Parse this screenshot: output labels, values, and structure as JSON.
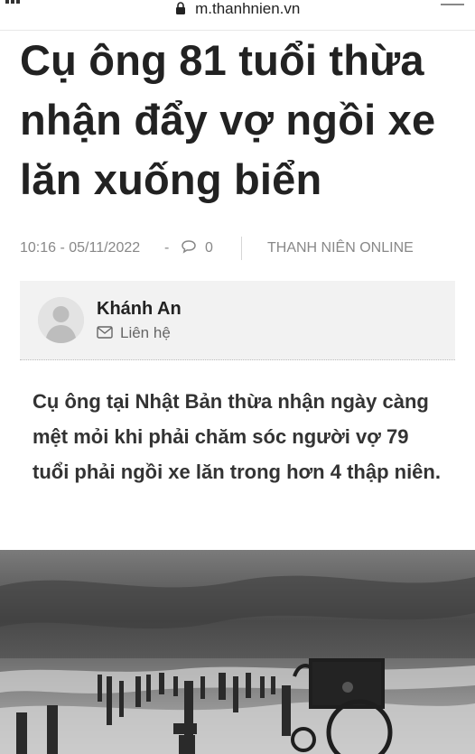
{
  "browser": {
    "url": "m.thanhnien.vn",
    "icons": {
      "lock": "lock-icon",
      "menu": "menu-icon"
    }
  },
  "article": {
    "title": "Cụ ông 81 tuổi thừa nhận đẩy vợ ngồi xe lăn xuống biển",
    "published": "10:16 - 05/11/2022",
    "separator": "-",
    "comment_count": "0",
    "source": "THANH NIÊN ONLINE",
    "author": {
      "name": "Khánh An",
      "contact_label": "Liên hệ"
    },
    "sapo": "Cụ ông tại Nhật Bản thừa nhận ngày càng mệt mỏi khi phải chăm sóc người vợ 79 tuổi phải ngồi xe lăn trong hơn 4 thập niên."
  },
  "colors": {
    "title": "#222222",
    "meta": "#888888",
    "author_box_bg": "#f2f2f2",
    "sapo": "#333333"
  }
}
